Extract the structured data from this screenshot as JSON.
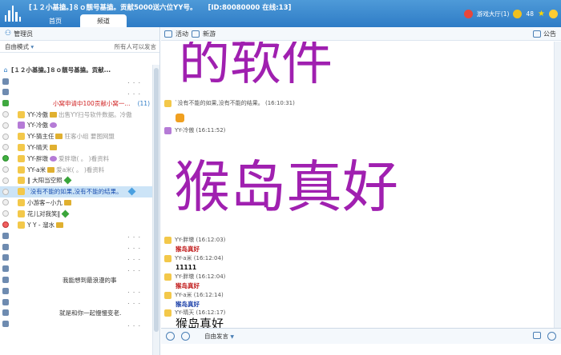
{
  "window": {
    "title": "[１２小基搕。]８ｏ靓号基搕。贡献5000送六位YY号。",
    "id_online": "[ID:80080000 在线:13]"
  },
  "tabs": [
    {
      "label": "首页"
    },
    {
      "label": "频道"
    }
  ],
  "top_right": {
    "lobby": "游戏大厅(1)",
    "coins": "48"
  },
  "left": {
    "admin_label": "管理员",
    "mode_label": "自由模式",
    "mode_note": "所有人可以发言",
    "channel_title": "[１２小基搕。]８ｏ靓号基搕。贡献...",
    "dots": ". . .",
    "red_channel": "小窝申请中100贡献小窝一...",
    "red_count": "(11)",
    "users": [
      {
        "name": "YY-冷傲",
        "note": "出售YY扫号软件数据。冷傲"
      },
      {
        "name": "YY-冷傲",
        "note": ""
      },
      {
        "name": "YY-猜主任",
        "note": "狂客小组 要图网盟"
      },
      {
        "name": "YY-晴天",
        "note": ""
      },
      {
        "name": "YY-胖墩",
        "note": "爱胖墩( 。 )看资料"
      },
      {
        "name": "YY-a米",
        "note": "爱a米( 。 )看资料"
      },
      {
        "name": "‖ 大阳当空照",
        "note": ""
      },
      {
        "name": "`没有不能的如果,没有不能的结果。",
        "note": ""
      },
      {
        "name": "小游客~小九",
        "note": ""
      },
      {
        "name": "花儿对我笑‖",
        "note": ""
      },
      {
        "name": "Y Y - 溜水",
        "note": ""
      }
    ],
    "center_msgs": [
      "我能想到最浪漫的事",
      "就是和你一起慢慢变老."
    ]
  },
  "chat": {
    "activity_label": "活动",
    "newbie_label": "新游",
    "notice_label": "公告",
    "big_text_1": "的软件",
    "big_text_2": "猴岛真好",
    "messages": [
      {
        "sender": "`没有不能的如果,没有不能的结果。",
        "time": "(16:10:31)"
      },
      {
        "sender": "YY-冷傲",
        "time": "(16:11:52)"
      },
      {
        "sender": "YY-胖墩",
        "time": "(16:12:03)",
        "body": "猴岛真好"
      },
      {
        "sender": "YY-a米",
        "time": "(16:12:04)",
        "body": "11111"
      },
      {
        "sender": "YY-胖墩",
        "time": "(16:12:04)",
        "body": "猴岛真好"
      },
      {
        "sender": "YY-a米",
        "time": "(16:12:14)",
        "body": "猴岛真好"
      },
      {
        "sender": "YY-晴天",
        "time": "(16:12:17)",
        "body": "猴岛真好"
      }
    ],
    "mode_select": "自由发言"
  }
}
